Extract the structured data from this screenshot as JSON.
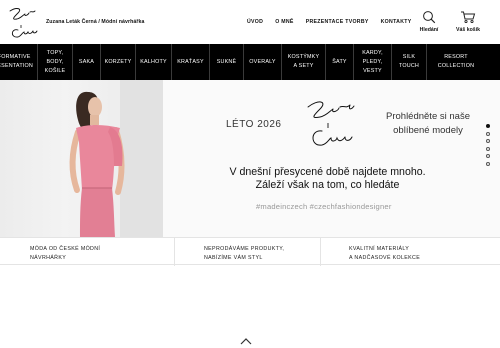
{
  "header": {
    "brand": "Zuzana Leták Černá / Módní návrhářka",
    "nav": [
      "ÚVOD",
      "O MNĚ",
      "PREZENTACE TVORBY",
      "KONTAKTY"
    ],
    "search_label": "Hledání",
    "cart_label": "Váš košík",
    "icons": {
      "search": "search-icon",
      "cart": "cart-icon"
    }
  },
  "categories": [
    "INFORMATIVE|PRESENTATION",
    "TOPY,|BODY,|KOŠILE",
    "SAKA",
    "KORZETY",
    "KALHOTY",
    "KRAŤASY",
    "SUKNĚ",
    "OVERALY",
    "KOSTÝMKY|A SETY",
    "ŠATY",
    "KARDY,|PLEDY,|VESTY",
    "SILK|TOUCH",
    "RESORT|COLLECTION"
  ],
  "hero": {
    "season": "LÉTO 2026",
    "promo": "Prohlédněte si naše oblíbené modely",
    "slogan": "V dnešní přesycené době najdete mnoho. Záleží však na tom, co hledáte",
    "hashtags": "#madeinczech #czechfashiondesigner",
    "slides": 6,
    "active_slide": 0
  },
  "features": [
    "MÓDA OD ČESKÉ MÓDNÍ|NÁVRHÁŘKY",
    "NEPRODÁVÁME PRODUKTY,|NABÍZÍME VÁM STYL",
    "KVALITNÍ MATERIÁLY|A NADČASOVÉ KOLEKCE"
  ],
  "colors": {
    "category_bar": "#000000",
    "dress": "#e9879b",
    "text": "#111111",
    "hashtag": "#999999"
  }
}
